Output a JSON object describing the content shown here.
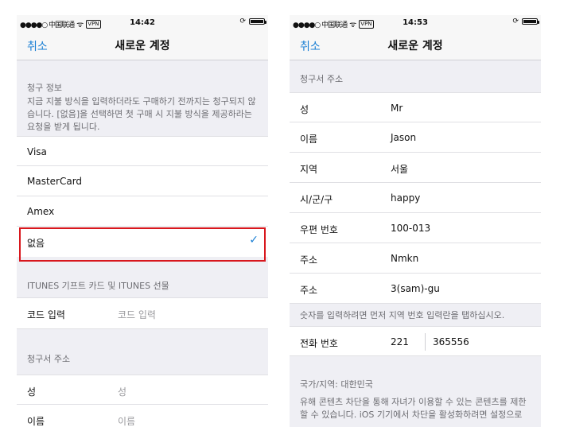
{
  "left": {
    "status": {
      "carrier": "●●●●○ 中国联通",
      "vpn": "VPN",
      "time": "14:42"
    },
    "nav": {
      "cancel": "취소",
      "title": "새로운 계정"
    },
    "billing": {
      "header": "청구 정보",
      "description": "지금 지불 방식을 입력하더라도 구매하기 전까지는 청구되지 않습니다. [없음]을 선택하면 첫 구매 시 지불 방식을 제공하라는 요청을 받게 됩니다.",
      "options": [
        "Visa",
        "MasterCard",
        "Amex",
        "없음"
      ],
      "selected": "없음"
    },
    "gift": {
      "header": "ITUNES 기프트 카드 및 ITUNES 선물",
      "label": "코드 입력",
      "placeholder": "코드 입력"
    },
    "address": {
      "header": "청구서 주소",
      "rows": [
        {
          "label": "성",
          "placeholder": "성"
        },
        {
          "label": "이름",
          "placeholder": "이름"
        }
      ]
    }
  },
  "right": {
    "status": {
      "carrier": "●●●●○ 中国联通",
      "vpn": "VPN",
      "time": "14:53"
    },
    "nav": {
      "cancel": "취소",
      "title": "새로운 계정"
    },
    "address": {
      "header": "청구서 주소",
      "rows": [
        {
          "label": "성",
          "value": "Mr"
        },
        {
          "label": "이름",
          "value": "Jason"
        },
        {
          "label": "지역",
          "value": "서울"
        },
        {
          "label": "시/군/구",
          "value": "happy"
        },
        {
          "label": "우편 번호",
          "value": "100-013"
        },
        {
          "label": "주소",
          "value": "Nmkn"
        },
        {
          "label": "주소",
          "value": "3(sam)-gu"
        }
      ]
    },
    "hint": "숫자를 입력하려면 먼저 지역 번호 입력란을 탭하십시오.",
    "phone": {
      "label": "전화 번호",
      "area_code": "221",
      "number": "365556"
    },
    "country": "국가/지역: 대한민국",
    "parental": "유해 콘텐츠 차단을 통해 자녀가 이용할 수 있는 콘텐츠를 제한할 수 있습니다. iOS 기기에서 차단을 활성화하려면 설정으로"
  }
}
